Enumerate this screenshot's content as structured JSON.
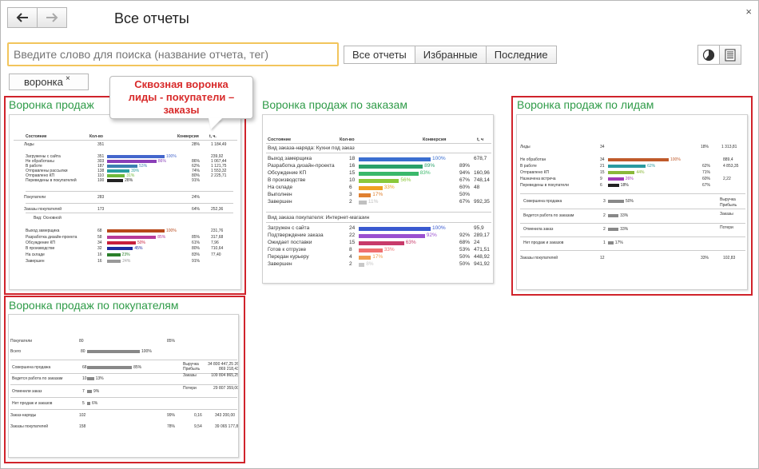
{
  "window": {
    "title": "Все отчеты",
    "close_glyph": "×"
  },
  "search": {
    "placeholder": "Введите слово для поиска (название отчета, тег)"
  },
  "filters": [
    {
      "label": "Все отчеты",
      "active": true
    },
    {
      "label": "Избранные",
      "active": false
    },
    {
      "label": "Последние",
      "active": false
    }
  ],
  "tag": {
    "label": "воронка",
    "remove_glyph": "×"
  },
  "callout": {
    "line1": "Сквозная воронка",
    "line2": "лиды - покупатели –",
    "line3": "заказы"
  },
  "reports": {
    "sales_funnel": {
      "title": "Воронка продаж",
      "headers": [
        "Состояние",
        "Кол-во",
        "Конверсия",
        "t, ч."
      ],
      "rows": [
        {
          "label": "Лиды",
          "qty": "351",
          "pct": "28%",
          "time": "1 184,49",
          "bar": 0,
          "color": ""
        },
        {
          "label": "Загружены с сайта",
          "qty": "351",
          "pct": "",
          "time": "239,92",
          "bar": 1.0,
          "color": "#4466cc",
          "bl": "100%"
        },
        {
          "label": "Не обработаны",
          "qty": "303",
          "pct": "86%",
          "time": "1 067,44",
          "bar": 0.86,
          "color": "#8a3fb8",
          "bl": "86%"
        },
        {
          "label": "В работе",
          "qty": "187",
          "pct": "62%",
          "time": "1 121,75",
          "bar": 0.53,
          "color": "#3c7fb1",
          "bl": "53%"
        },
        {
          "label": "Отправлены рассылки",
          "qty": "138",
          "pct": "74%",
          "time": "1 553,32",
          "bar": 0.39,
          "color": "#2aa0a0",
          "bl": "39%"
        },
        {
          "label": "Отправлено КП",
          "qty": "110",
          "pct": "80%",
          "time": "2 225,71",
          "bar": 0.31,
          "color": "#6fb83a",
          "bl": "31%"
        },
        {
          "label": "Переведены в покупателей",
          "qty": "100",
          "pct": "91%",
          "time": "",
          "bar": 0.28,
          "color": "#222",
          "bl": "28%"
        },
        {
          "label": "Покупатели",
          "qty": "283",
          "pct": "24%",
          "time": "",
          "bar": 0,
          "color": ""
        },
        {
          "label": "Заказы покупателей",
          "qty": "173",
          "pct": "64%",
          "time": "252,36",
          "bar": 0,
          "color": ""
        },
        {
          "label": "Вид: Основной",
          "qty": "",
          "pct": "",
          "time": "",
          "bar": 0,
          "color": ""
        },
        {
          "label": "Выход замерщика",
          "qty": "68",
          "pct": "",
          "time": "231,76",
          "bar": 1.0,
          "color": "#b8481a",
          "bl": "100%"
        },
        {
          "label": "Разработка дизайн-проекта",
          "qty": "58",
          "pct": "85%",
          "time": "317,68",
          "bar": 0.85,
          "color": "#b83a9a",
          "bl": "85%"
        },
        {
          "label": "Обсуждение КП",
          "qty": "34",
          "pct": "61%",
          "time": "7,96",
          "bar": 0.5,
          "color": "#c81e3c",
          "bl": "50%"
        },
        {
          "label": "В производстве",
          "qty": "32",
          "pct": "80%",
          "time": "710,64",
          "bar": 0.45,
          "color": "#1e2aa0",
          "bl": "45%"
        },
        {
          "label": "На складе",
          "qty": "16",
          "pct": "83%",
          "time": "77,40",
          "bar": 0.23,
          "color": "#2a7f2a",
          "bl": "23%"
        },
        {
          "label": "Завершен",
          "qty": "16",
          "pct": "91%",
          "time": "",
          "bar": 0.24,
          "color": "#999",
          "bl": "24%"
        }
      ]
    },
    "by_orders": {
      "title": "Воронка продаж по заказам",
      "headers": [
        "Состояние",
        "Кол-во",
        "Конверсия",
        "t, ч"
      ],
      "group1": "Вид заказа-наряда: Кухни под заказ",
      "rows1": [
        {
          "label": "Выход замерщика",
          "qty": "18",
          "pct": "",
          "time": "678,7",
          "bar": 1.0,
          "color": "#3a6ed0",
          "bl": "100%"
        },
        {
          "label": "Разработка дизайн-проекта",
          "qty": "16",
          "pct": "89%",
          "time": "",
          "bar": 0.89,
          "color": "#2aa06a",
          "bl": "89%"
        },
        {
          "label": "Обсуждение КП",
          "qty": "15",
          "pct": "94%",
          "time": "160,96",
          "bar": 0.83,
          "color": "#3ab86a",
          "bl": "83%"
        },
        {
          "label": "В производстве",
          "qty": "10",
          "pct": "67%",
          "time": "748,14",
          "bar": 0.56,
          "color": "#8ac83a",
          "bl": "56%"
        },
        {
          "label": "На складе",
          "qty": "6",
          "pct": "60%",
          "time": "48",
          "bar": 0.33,
          "color": "#f0a020",
          "bl": "33%"
        },
        {
          "label": "Выполнен",
          "qty": "3",
          "pct": "50%",
          "time": "",
          "bar": 0.17,
          "color": "#e08030",
          "bl": "17%"
        },
        {
          "label": "Завершен",
          "qty": "2",
          "pct": "67%",
          "time": "992,35",
          "bar": 0.11,
          "color": "#c0c0c0",
          "bl": "11%"
        }
      ],
      "group2": "Вид заказа покупателя: Интернет-магазин",
      "rows2": [
        {
          "label": "Загружен с сайта",
          "qty": "24",
          "pct": "",
          "time": "95,9",
          "bar": 1.0,
          "color": "#3a5ad0",
          "bl": "100%"
        },
        {
          "label": "Подтверждение заказа",
          "qty": "22",
          "pct": "92%",
          "time": "289,17",
          "bar": 0.92,
          "color": "#9a50d0",
          "bl": "92%"
        },
        {
          "label": "Ожидает поставки",
          "qty": "15",
          "pct": "68%",
          "time": "24",
          "bar": 0.63,
          "color": "#c83a6a",
          "bl": "63%"
        },
        {
          "label": "Готов к отгрузке",
          "qty": "8",
          "pct": "53%",
          "time": "471,51",
          "bar": 0.33,
          "color": "#f07070",
          "bl": "33%"
        },
        {
          "label": "Передан курьеру",
          "qty": "4",
          "pct": "50%",
          "time": "448,92",
          "bar": 0.17,
          "color": "#f0a050",
          "bl": "17%"
        },
        {
          "label": "Завершен",
          "qty": "2",
          "pct": "50%",
          "time": "941,92",
          "bar": 0.08,
          "color": "#c8c8c8",
          "bl": "8%"
        }
      ]
    },
    "by_leads": {
      "title": "Воронка продаж по лидам",
      "head": {
        "label": "Лиды",
        "qty": "34",
        "pct": "18%",
        "time": "1 313,81"
      },
      "rows": [
        {
          "label": "Не обработан",
          "qty": "34",
          "pct": "",
          "time": "889,4",
          "bar": 1.0,
          "color": "#c05a2a",
          "bl": "100%"
        },
        {
          "label": "В работе",
          "qty": "21",
          "pct": "62%",
          "time": "4 853,35",
          "bar": 0.62,
          "color": "#2a9aa0",
          "bl": "62%"
        },
        {
          "label": "Отправлено КП",
          "qty": "15",
          "pct": "71%",
          "time": "",
          "bar": 0.44,
          "color": "#8ab83a",
          "bl": "44%"
        },
        {
          "label": "Назначена встреча",
          "qty": "9",
          "pct": "60%",
          "time": "2,22",
          "bar": 0.26,
          "color": "#a03ab8",
          "bl": "26%"
        },
        {
          "label": "Переведены в покупатели",
          "qty": "6",
          "pct": "67%",
          "time": "",
          "bar": 0.18,
          "color": "#222",
          "bl": "18%"
        }
      ],
      "sub": [
        {
          "label": "Совершена продажа",
          "qty": "3",
          "bl": "50%",
          "bar": 0.5,
          "note": "Выручка Прибыль"
        },
        {
          "label": "Ведется работа по заказам",
          "qty": "2",
          "bl": "33%",
          "bar": 0.33,
          "note": "Заказы"
        },
        {
          "label": "Отменила заказ",
          "qty": "2",
          "bl": "33%",
          "bar": 0.33,
          "note": "Потери"
        },
        {
          "label": "Нет продаж и заказов",
          "qty": "1",
          "bl": "17%",
          "bar": 0.17,
          "note": ""
        }
      ],
      "foot": {
        "label": "Заказы покупателей",
        "qty": "12",
        "pct": "33%",
        "time": "102,83"
      }
    },
    "by_customers": {
      "title": "Воронка продаж по покупателям",
      "head": {
        "label": "Покупатели",
        "qty": "80",
        "pct": "85%"
      },
      "total": {
        "label": "Всего",
        "qty": "80",
        "bl": "100%",
        "bar": 1.0
      },
      "sub": [
        {
          "label": "Совершена продажа",
          "qty": "68",
          "bl": "85%",
          "bar": 0.85,
          "note": "Выручка Прибыль",
          "val": "34 800 447,25 26 869 218,43"
        },
        {
          "label": "Ведется работа по заказам",
          "qty": "10",
          "bl": "13%",
          "bar": 0.13,
          "note": "Заказы",
          "val": "109 804 865,25"
        },
        {
          "label": "Отменили заказ",
          "qty": "7",
          "bl": "9%",
          "bar": 0.09,
          "note": "Потери",
          "val": "29 807 359,00"
        },
        {
          "label": "Нет продаж и заказов",
          "qty": "5",
          "bl": "6%",
          "bar": 0.06,
          "note": "",
          "val": ""
        }
      ],
      "foot": [
        {
          "label": "Заказ-наряды",
          "qty": "102",
          "pct": "99%",
          "a": "0,16",
          "b": "343 200,00"
        },
        {
          "label": "Заказы покупателей",
          "qty": "158",
          "pct": "78%",
          "a": "9,54",
          "b": "39 065 177,89"
        }
      ]
    }
  }
}
